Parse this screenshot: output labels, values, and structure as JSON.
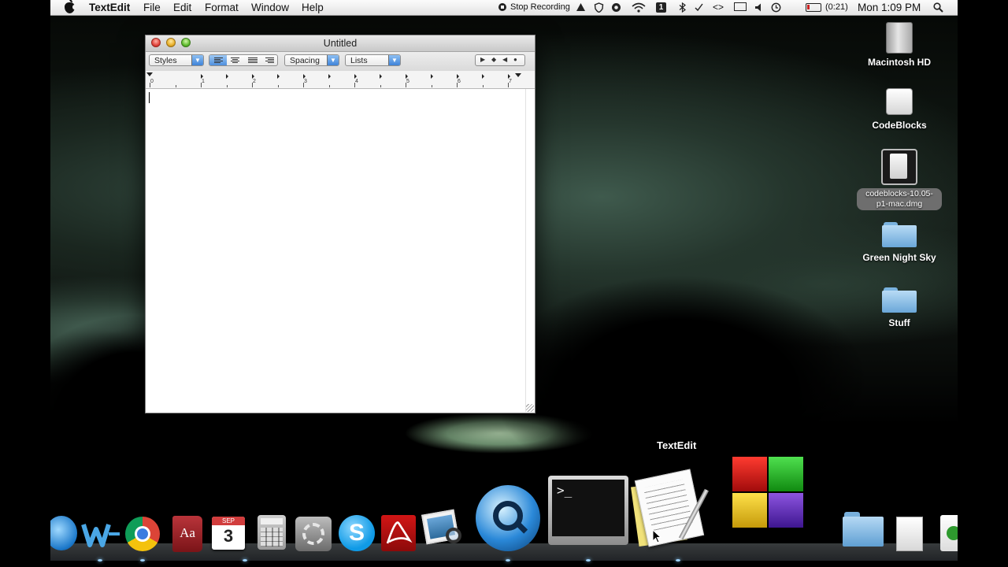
{
  "menubar": {
    "app_name": "TextEdit",
    "menus": [
      "File",
      "Edit",
      "Format",
      "Window",
      "Help"
    ],
    "stop_recording": "Stop Recording",
    "battery_time": "(0:21)",
    "clock": "Mon 1:09 PM"
  },
  "window": {
    "title": "Untitled",
    "toolbar": {
      "styles_label": "Styles",
      "spacing_label": "Spacing",
      "lists_label": "Lists"
    },
    "ruler_numbers": [
      "0",
      "1",
      "2",
      "3",
      "4",
      "5",
      "6",
      "7"
    ]
  },
  "desktop_icons": [
    {
      "label": "Macintosh HD",
      "icon": "hard-drive-icon"
    },
    {
      "label": "CodeBlocks",
      "icon": "external-drive-icon"
    },
    {
      "label": "codeblocks-10.05-p1-mac.dmg",
      "icon": "dmg-file-icon"
    },
    {
      "label": "Green Night Sky",
      "icon": "folder-icon"
    },
    {
      "label": "Stuff",
      "icon": "folder-icon"
    }
  ],
  "dock": {
    "tooltip": "TextEdit",
    "calendar_month": "SEP",
    "calendar_day": "3",
    "dictionary_glyph": "Aa",
    "terminal_prompt": ">_",
    "items": [
      "itunes-icon",
      "word-icon",
      "chrome-icon",
      "dictionary-icon",
      "ical-icon",
      "calculator-icon",
      "system-preferences-icon",
      "skype-icon",
      "acrobat-icon",
      "preview-icon",
      "quicktime-icon",
      "terminal-icon",
      "textedit-icon",
      "office-icon",
      "downloads-folder-icon",
      "document-stack-icon",
      "utorrent-icon"
    ]
  },
  "colors": {
    "menubar_bg": "#ececec",
    "selection_blue": "#4f90dd",
    "desktop_green": "#3f5a4d"
  }
}
